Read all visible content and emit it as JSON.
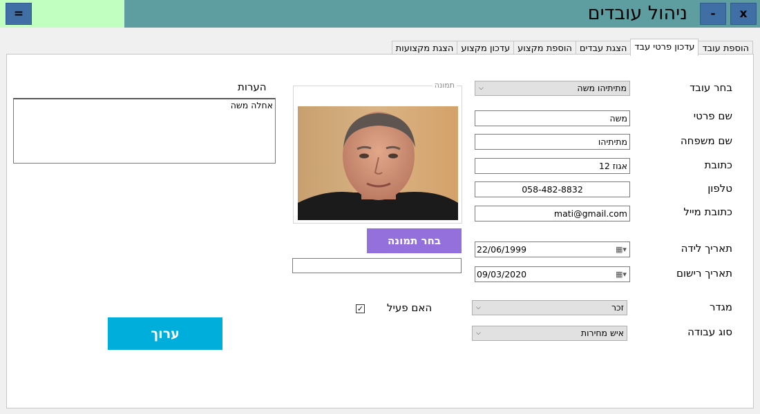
{
  "window": {
    "title": "ניהול עובדים",
    "menu_button": "=",
    "minimize_button": "-",
    "close_button": "x"
  },
  "tabs": [
    {
      "label": "הוספת עובד",
      "active": false
    },
    {
      "label": "עדכון פרטי עבד",
      "active": true
    },
    {
      "label": "הצגת עבדים",
      "active": false
    },
    {
      "label": "הוספת מקצוע",
      "active": false
    },
    {
      "label": "עדכון מקצוע",
      "active": false
    },
    {
      "label": "הצגת מקצועות",
      "active": false
    }
  ],
  "form": {
    "select_employee": {
      "label": "בחר עובד",
      "value": "מתיתיהו משה"
    },
    "first_name": {
      "label": "שם פרטי",
      "value": "משה"
    },
    "last_name": {
      "label": "שם משפחה",
      "value": "מתיתיהו"
    },
    "address": {
      "label": "כתובת",
      "value": "אגוז 12"
    },
    "phone": {
      "label": "טלפון",
      "value": "058-482-8832"
    },
    "email": {
      "label": "כתובת מייל",
      "value": "mati@gmail.com"
    },
    "birth_date": {
      "label": "תאריך לידה",
      "value": "22/06/1999"
    },
    "registration_date": {
      "label": "תאריך רישום",
      "value": "09/03/2020"
    },
    "gender": {
      "label": "מגדר",
      "value": "זכר"
    },
    "job_type": {
      "label": "סוג עבודה",
      "value": "איש מחירות"
    }
  },
  "photo_group": {
    "label": "תמונה",
    "choose_button": "בחר תמונה",
    "path_value": ""
  },
  "active_check": {
    "label": "האם פעיל",
    "checked": true,
    "mark": "✓"
  },
  "notes": {
    "label": "הערות",
    "value": "אחלה משה"
  },
  "edit_button": "ערוך",
  "colors": {
    "titlebar": "#5f9ea0",
    "title_accent": "#c0ffc0",
    "window_buttons": "#3f6fa5",
    "choose_photo_button": "#9370db",
    "edit_button": "#00aedb"
  },
  "icons": {
    "dropdown": "chevron-down-icon",
    "calendar": "calendar-icon",
    "checkbox": "checkbox-icon"
  }
}
